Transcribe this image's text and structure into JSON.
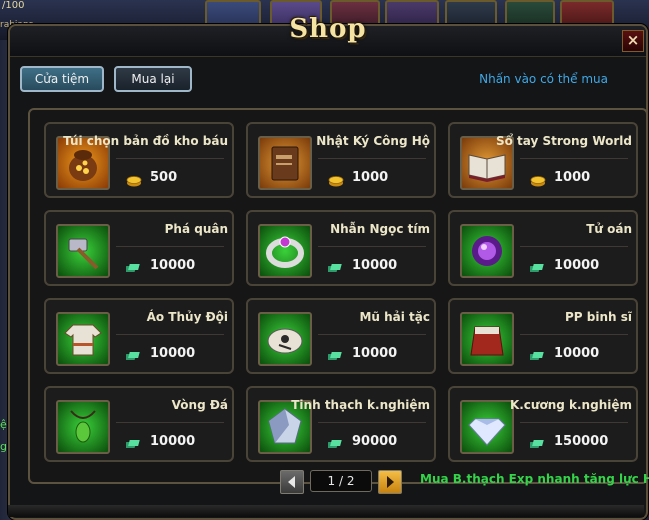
{
  "game_bg": {
    "top_left_value": "/100",
    "left_label": "rabians",
    "side_glyph": "ệ",
    "side_glyph_2": "g"
  },
  "shop": {
    "title": "Shop",
    "close_label": "×",
    "tabs": [
      {
        "label": "Cửa tiệm",
        "active": true
      },
      {
        "label": "Mua lại",
        "active": false
      }
    ],
    "hint": "Nhấn vào có thể mua",
    "currency_colors": {
      "gold": "#f1c232",
      "gem": "#3fd18c"
    },
    "items": [
      {
        "name": "Túi chọn bản đồ kho báu",
        "price": "500",
        "currency": "gold",
        "icon": "treasure-bag-icon",
        "bg": "orange"
      },
      {
        "name": "Nhật Ký Công Hộ",
        "price": "1000",
        "currency": "gold",
        "icon": "diary-book-icon",
        "bg": "brown"
      },
      {
        "name": "Sổ tay Strong World",
        "price": "1000",
        "currency": "gold",
        "icon": "open-book-icon",
        "bg": "brown"
      },
      {
        "name": "Phá quân",
        "price": "10000",
        "currency": "gem",
        "icon": "hammer-icon",
        "bg": "green"
      },
      {
        "name": "Nhẫn Ngọc tím",
        "price": "10000",
        "currency": "gem",
        "icon": "ring-icon",
        "bg": "green"
      },
      {
        "name": "Tử oán",
        "price": "10000",
        "currency": "gem",
        "icon": "purple-orb-icon",
        "bg": "green"
      },
      {
        "name": "Áo Thủy Đội",
        "price": "10000",
        "currency": "gem",
        "icon": "navy-shirt-icon",
        "bg": "green"
      },
      {
        "name": "Mũ hải tặc",
        "price": "10000",
        "currency": "gem",
        "icon": "pirate-bandana-icon",
        "bg": "green"
      },
      {
        "name": "PP binh sĩ",
        "price": "10000",
        "currency": "gem",
        "icon": "soldier-cape-icon",
        "bg": "green"
      },
      {
        "name": "Vòng Đá",
        "price": "10000",
        "currency": "gem",
        "icon": "stone-necklace-icon",
        "bg": "green"
      },
      {
        "name": "Tinh thạch k.nghiệm",
        "price": "90000",
        "currency": "gem",
        "icon": "crystal-icon",
        "bg": "green"
      },
      {
        "name": "K.cương k.nghiệm",
        "price": "150000",
        "currency": "gem",
        "icon": "diamond-icon",
        "bg": "green"
      }
    ],
    "pagination": {
      "current": 1,
      "total": 2,
      "label": "1 / 2"
    },
    "promo_text": "Mua B.thạch Exp nhanh tăng lực HĐ"
  }
}
